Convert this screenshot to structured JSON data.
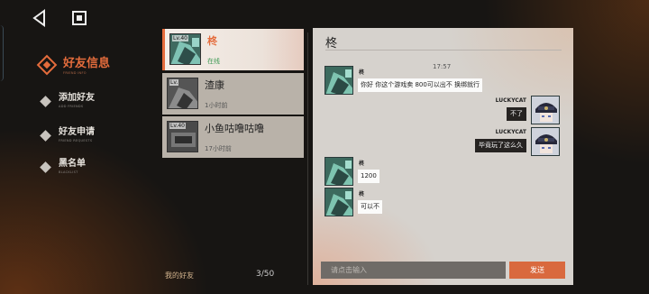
{
  "nav": {
    "back_icon": "triangle-left-icon",
    "home_icon": "square-stop-icon"
  },
  "side_menu": [
    {
      "label": "好友信息",
      "sub": "FRIEND INFO",
      "active": true
    },
    {
      "label": "添加好友",
      "sub": "ADD FRIENDS",
      "active": false
    },
    {
      "label": "好友申请",
      "sub": "FRIEND REQUESTS",
      "active": false
    },
    {
      "label": "黑名单",
      "sub": "BLACKLIST",
      "active": false
    }
  ],
  "friend_list": {
    "items": [
      {
        "level": "Lv.40",
        "name": "柊",
        "status": "在线",
        "online": true
      },
      {
        "level": "Lv.",
        "name": "渣康",
        "status": "1小时前",
        "online": false
      },
      {
        "level": "Lv.40",
        "name": "小鱼咕噜咕噜",
        "status": "17小时前",
        "online": false
      }
    ],
    "footer_label": "我的好友",
    "count": "3/50"
  },
  "chat": {
    "title": "柊",
    "timestamp": "17:57",
    "messages": [
      {
        "sender": "柊",
        "incoming": true,
        "text": "你好 你这个游戏卖 800可以出不 换绑就行"
      },
      {
        "sender": "LUCKYCAT",
        "incoming": false,
        "text": "不了"
      },
      {
        "sender": "LUCKYCAT",
        "incoming": false,
        "text": "毕竟玩了这么久"
      },
      {
        "sender": "柊",
        "incoming": true,
        "text": "1200"
      },
      {
        "sender": "柊",
        "incoming": true,
        "text": "可以不"
      }
    ],
    "input_placeholder": "请点击输入",
    "send_label": "发送"
  },
  "colors": {
    "accent": "#e46c3c",
    "online": "#3e9a54",
    "send": "#d9693e"
  }
}
